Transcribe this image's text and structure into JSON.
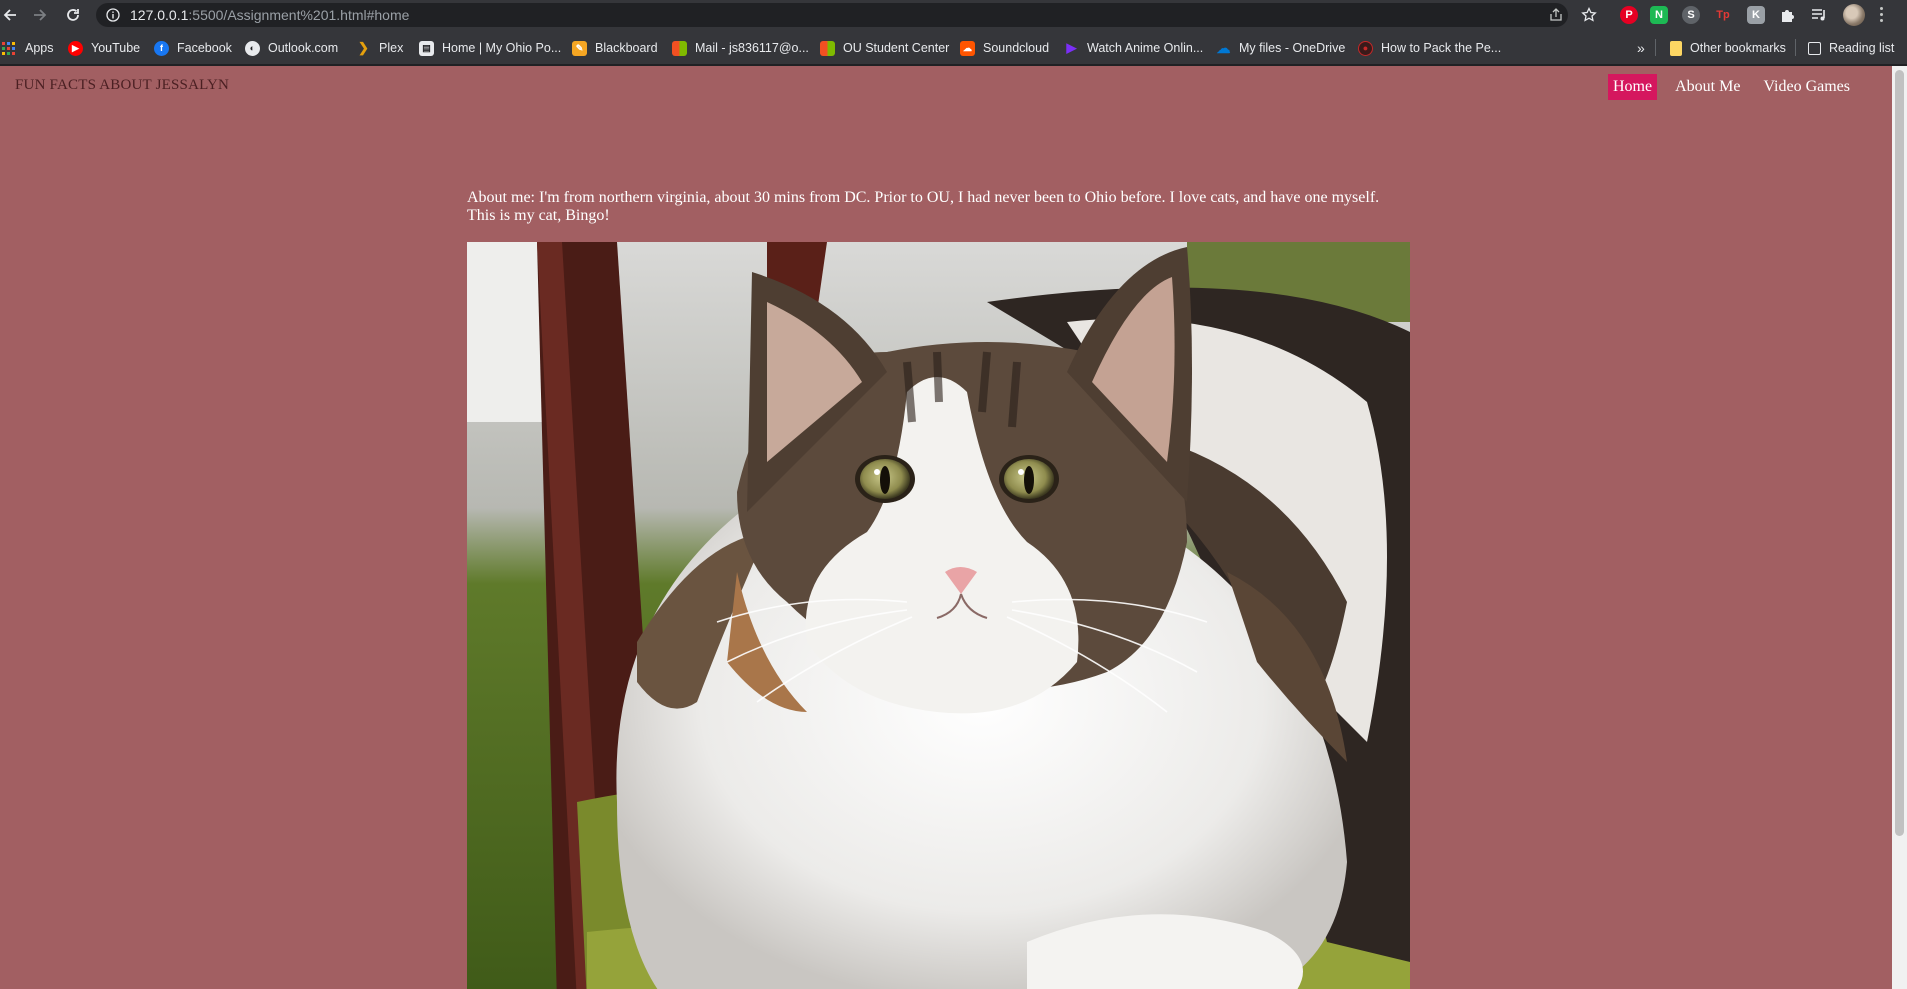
{
  "browser": {
    "url_host": "127.0.0.1",
    "url_rest": ":5500/Assignment%201.html#home",
    "bookmarks": [
      {
        "label": "Apps",
        "icon": "apps-grid-icon",
        "color": "#4285f4"
      },
      {
        "label": "YouTube",
        "icon": "youtube-icon",
        "color": "#ff0000"
      },
      {
        "label": "Facebook",
        "icon": "facebook-icon",
        "color": "#1877f2"
      },
      {
        "label": "Outlook.com",
        "icon": "outlook-icon",
        "color": "#e8eaed"
      },
      {
        "label": "Plex",
        "icon": "plex-icon",
        "color": "#e5a00d"
      },
      {
        "label": "Home | My Ohio Po...",
        "icon": "ohio-portal-icon",
        "color": "#e8eaed"
      },
      {
        "label": "Blackboard",
        "icon": "blackboard-icon",
        "color": "#f5a623"
      },
      {
        "label": "Mail - js836117@o...",
        "icon": "microsoft-mail-icon",
        "color": "#f25022"
      },
      {
        "label": "OU Student Center",
        "icon": "microsoft-icon",
        "color": "#f25022"
      },
      {
        "label": "Soundcloud",
        "icon": "soundcloud-icon",
        "color": "#ff5500"
      },
      {
        "label": "Watch Anime Onlin...",
        "icon": "play-icon",
        "color": "#7b2ff7"
      },
      {
        "label": "My files - OneDrive",
        "icon": "onedrive-icon",
        "color": "#0078d4"
      },
      {
        "label": "How to Pack the Pe...",
        "icon": "video-icon",
        "color": "#c62828"
      }
    ],
    "overflow_label": "»",
    "other_bookmarks": "Other bookmarks",
    "reading_list": "Reading list"
  },
  "page": {
    "site_title": "FUN FACTS ABOUT JESSALYN",
    "nav": {
      "home": "Home",
      "about": "About Me",
      "games": "Video Games"
    },
    "about_line1": "About me: I'm from northern virginia, about 30 mins from DC. Prior to OU, I had never been to Ohio before. I love cats, and have one myself.",
    "about_line2": "This is my cat, Bingo!",
    "colors": {
      "background": "#a25f62",
      "active_nav": "#d5175e",
      "title": "#4a1f22"
    }
  }
}
